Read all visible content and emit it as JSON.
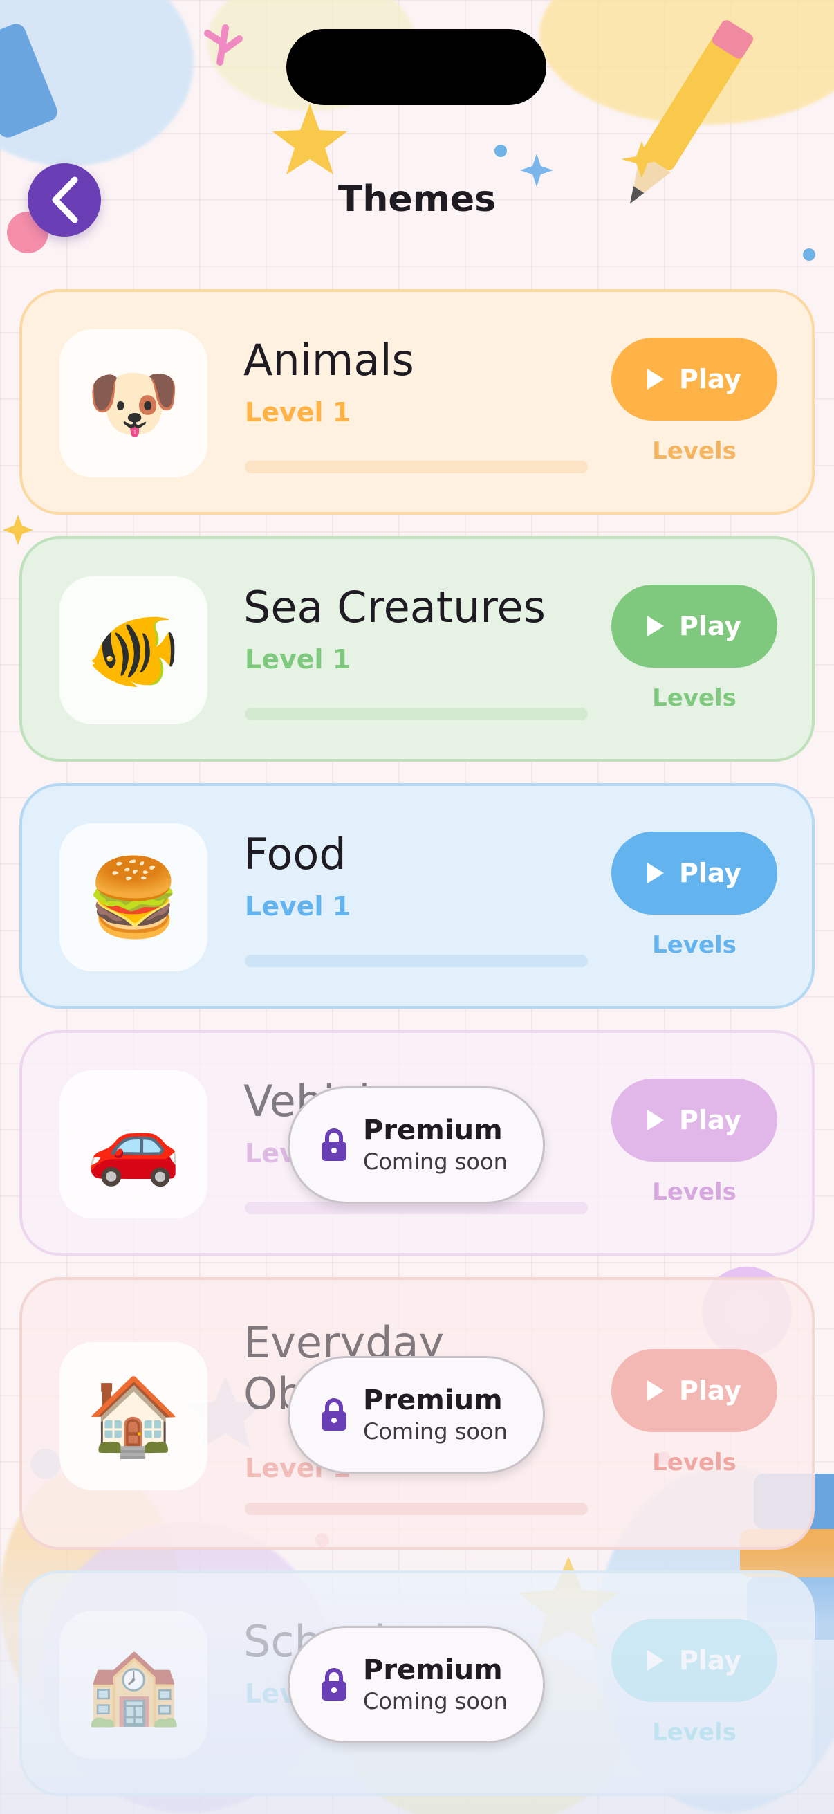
{
  "header": {
    "title": "Themes",
    "back_icon": "chevron-left-icon"
  },
  "colors": {
    "accent_purple": "#6a3fb5",
    "animals": "#ffb347",
    "sea": "#7fc97f",
    "food": "#63b3ee",
    "vehicles": "#d6a8df",
    "everyday": "#f0a7a3",
    "school": "#8fd9ea"
  },
  "themes": [
    {
      "title": "Animals",
      "level": "Level 1",
      "play_label": "Play",
      "levels_label": "Levels",
      "icon": "dog-face-icon",
      "emoji": "🐶",
      "progress": 0,
      "locked": false
    },
    {
      "title": "Sea Creatures",
      "level": "Level 1",
      "play_label": "Play",
      "levels_label": "Levels",
      "icon": "tropical-fish-icon",
      "emoji": "🐠",
      "progress": 0,
      "locked": false
    },
    {
      "title": "Food",
      "level": "Level 1",
      "play_label": "Play",
      "levels_label": "Levels",
      "icon": "hamburger-icon",
      "emoji": "🍔",
      "progress": 0,
      "locked": false
    },
    {
      "title": "Vehicles",
      "level": "Level 1",
      "play_label": "Play",
      "levels_label": "Levels",
      "icon": "car-icon",
      "emoji": "🚗",
      "progress": 0,
      "locked": true
    },
    {
      "title": "Everyday Objects",
      "level": "Level 1",
      "play_label": "Play",
      "levels_label": "Levels",
      "icon": "house-icon",
      "emoji": "🏠",
      "progress": 0,
      "locked": true
    },
    {
      "title": "School",
      "level": "Level 1",
      "play_label": "Play",
      "levels_label": "Levels",
      "icon": "school-icon",
      "emoji": "🏫",
      "progress": 0,
      "locked": true
    }
  ],
  "premium": {
    "title": "Premium",
    "subtitle": "Coming soon",
    "icon": "lock-icon"
  }
}
